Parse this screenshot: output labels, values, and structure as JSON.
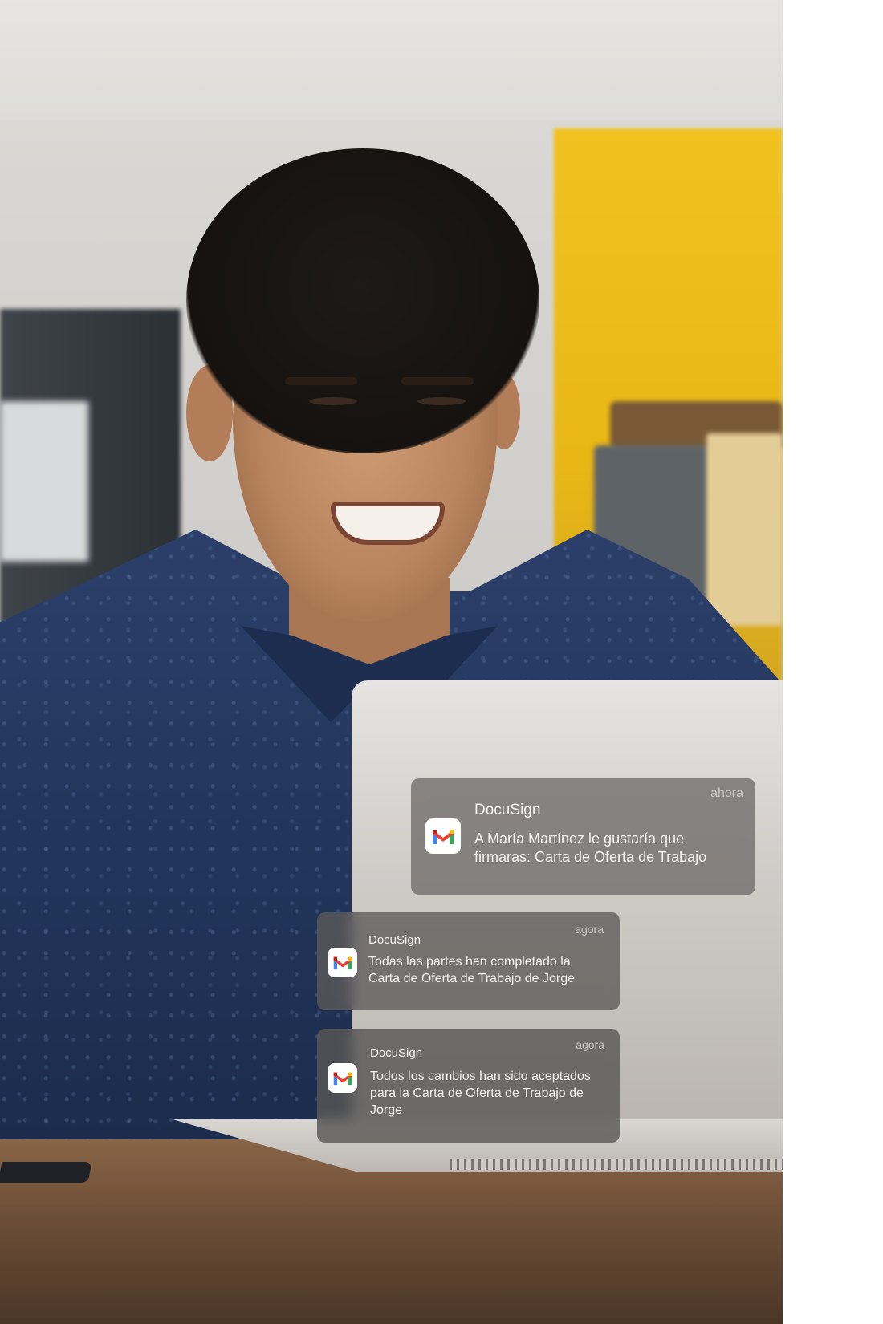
{
  "notifications": [
    {
      "app_icon": "gmail-icon",
      "sender": "DocuSign",
      "time": "ahora",
      "message": "A María Martínez le gustaría que firmaras: Carta de Oferta de Trabajo"
    },
    {
      "app_icon": "gmail-icon",
      "sender": "DocuSign",
      "time": "agora",
      "message": "Todas las partes han completado la Carta de Oferta de Trabajo de Jorge"
    },
    {
      "app_icon": "gmail-icon",
      "sender": "DocuSign",
      "time": "agora",
      "message": "Todos los cambios han sido aceptados para la Carta de Oferta de Trabajo de Jorge"
    }
  ],
  "colors": {
    "gmail_red": "#ea4335",
    "gmail_blue": "#4285f4",
    "gmail_green": "#34a853",
    "gmail_yellow": "#fbbc04",
    "gmail_dark_red": "#c5221f"
  }
}
